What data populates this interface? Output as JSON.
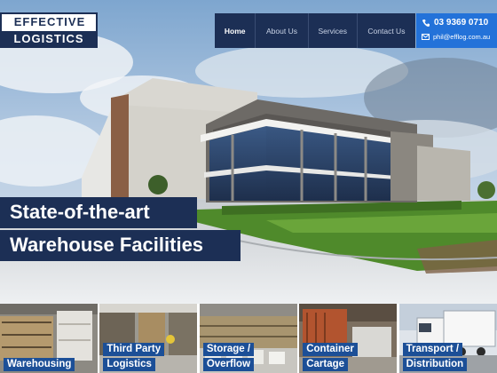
{
  "logo": {
    "line1": "EFFECTIVE",
    "line2": "LOGISTICS"
  },
  "nav": {
    "items": [
      {
        "label": "Home",
        "active": true
      },
      {
        "label": "About Us",
        "active": false
      },
      {
        "label": "Services",
        "active": false
      },
      {
        "label": "Contact Us",
        "active": false
      }
    ]
  },
  "contact": {
    "phone": "03 9369 0710",
    "email": "phil@efflog.com.au"
  },
  "hero": {
    "line1": "State-of-the-art",
    "line2": "Warehouse Facilities"
  },
  "tiles": [
    {
      "lines": [
        "Warehousing"
      ]
    },
    {
      "lines": [
        "Third Party",
        "Logistics"
      ]
    },
    {
      "lines": [
        "Storage /",
        "Overflow"
      ]
    },
    {
      "lines": [
        "Container",
        "Cartage"
      ]
    },
    {
      "lines": [
        "Transport /",
        "Distribution"
      ]
    }
  ],
  "colors": {
    "navy": "#1c2f55",
    "accent_blue": "#2372d9",
    "tile_label": "#1c4f97"
  }
}
